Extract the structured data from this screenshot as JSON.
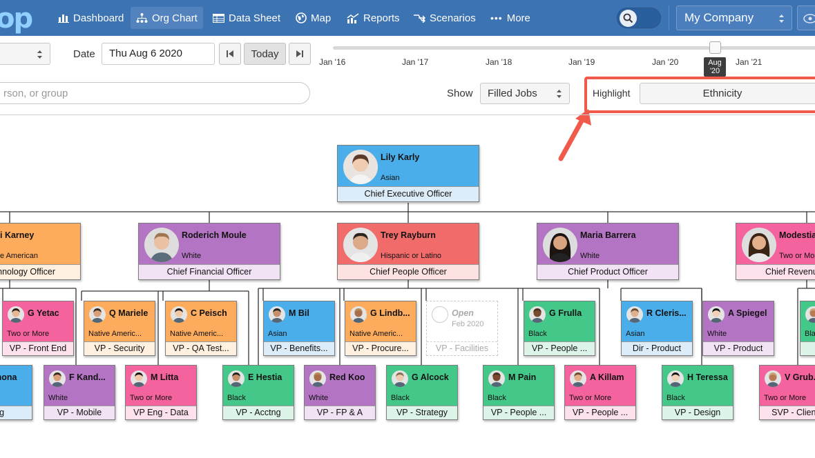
{
  "app": {
    "logo_text": "op",
    "nav": [
      {
        "label": "Dashboard",
        "icon": "bar-chart-icon"
      },
      {
        "label": "Org Chart",
        "icon": "org-chart-icon"
      },
      {
        "label": "Data Sheet",
        "icon": "table-icon"
      },
      {
        "label": "Map",
        "icon": "globe-icon"
      },
      {
        "label": "Reports",
        "icon": "trend-chart-icon"
      },
      {
        "label": "Scenarios",
        "icon": "branch-icon"
      },
      {
        "label": "More",
        "icon": "ellipsis-icon"
      }
    ],
    "active_nav": "Org Chart",
    "company": "My Company"
  },
  "toolbar": {
    "date_label": "Date",
    "date_value": "Thu Aug 6 2020",
    "today_label": "Today",
    "timeline_ticks": [
      "Jan '16",
      "Jan '17",
      "Jan '18",
      "Jan '19",
      "Jan '20",
      "Jan '21"
    ],
    "current_badge_line1": "Aug",
    "current_badge_line2": "'20",
    "search_placeholder": "rson, or group",
    "show_label": "Show",
    "show_value": "Filled Jobs",
    "highlight_label": "Highlight",
    "highlight_value": "Ethnicity"
  },
  "colors": {
    "nav_bg": "#3c73b3",
    "asian": "#4aaeea",
    "white": "#b474c4",
    "hispanic": "#f26b6b",
    "native_american": "#fdab5c",
    "two_or_more": "#f4639d",
    "black": "#44c88a",
    "annotation": "#f15a4a"
  },
  "org_chart": {
    "ceo": {
      "name": "Lily Karly",
      "ethnicity": "Asian",
      "title": "Chief Executive Officer"
    },
    "level2": [
      {
        "name": "i Karney",
        "ethnicity": "e American",
        "title": "hnology Officer",
        "group": "native_american"
      },
      {
        "name": "Roderich Moule",
        "ethnicity": "White",
        "title": "Chief Financial Officer",
        "group": "white"
      },
      {
        "name": "Trey Rayburn",
        "ethnicity": "Hispanic or Latino",
        "title": "Chief People Officer",
        "group": "hispanic"
      },
      {
        "name": "Maria Barrera",
        "ethnicity": "White",
        "title": "Chief Product Officer",
        "group": "white"
      },
      {
        "name": "Modestia",
        "ethnicity": "Two or Mor",
        "title": "Chief Revenu",
        "group": "two_or_more"
      }
    ],
    "level3": [
      {
        "name": "G Yetac",
        "ethnicity": "Two or More",
        "title": "VP - Front End",
        "group": "two_or_more"
      },
      {
        "name": "Q Mariele",
        "ethnicity": "Native Americ...",
        "title": "VP - Security",
        "group": "native_american"
      },
      {
        "name": "C Peisch",
        "ethnicity": "Native Americ...",
        "title": "VP - QA Test...",
        "group": "native_american"
      },
      {
        "name": "M Bil",
        "ethnicity": "Asian",
        "title": "VP - Benefits...",
        "group": "asian"
      },
      {
        "name": "G Lindb...",
        "ethnicity": "Native Americ...",
        "title": "VP - Procure...",
        "group": "native_american"
      },
      {
        "name": "Open",
        "ethnicity": "Feb 2020",
        "title": "VP - Facilities",
        "group": "open"
      },
      {
        "name": "G Frulla",
        "ethnicity": "Black",
        "title": "VP - People ...",
        "group": "black"
      },
      {
        "name": "R Cleris...",
        "ethnicity": "Asian",
        "title": "Dir - Product",
        "group": "asian"
      },
      {
        "name": "A Spiegel",
        "ethnicity": "White",
        "title": "VP - Product",
        "group": "white"
      },
      {
        "name": "",
        "ethnicity": "Bla",
        "title": "S",
        "group": "black"
      }
    ],
    "level4": [
      {
        "name": "Venona",
        "ethnicity": "",
        "title": "Eng",
        "group": "asian"
      },
      {
        "name": "F Kand...",
        "ethnicity": "White",
        "title": "VP - Mobile",
        "group": "white"
      },
      {
        "name": "M Litta",
        "ethnicity": "Two or More",
        "title": "VP Eng - Data",
        "group": "two_or_more"
      },
      {
        "name": "E Hestia",
        "ethnicity": "Black",
        "title": "VP - Acctng",
        "group": "black"
      },
      {
        "name": "Red Koo",
        "ethnicity": "White",
        "title": "VP - FP & A",
        "group": "white"
      },
      {
        "name": "G Alcock",
        "ethnicity": "Black",
        "title": "VP - Strategy",
        "group": "black"
      },
      {
        "name": "M Pain",
        "ethnicity": "Black",
        "title": "VP - People ...",
        "group": "black"
      },
      {
        "name": "A Killam",
        "ethnicity": "Two or More",
        "title": "VP - People ...",
        "group": "two_or_more"
      },
      {
        "name": "H Teressa",
        "ethnicity": "Black",
        "title": "VP - Design",
        "group": "black"
      },
      {
        "name": "V Grub...",
        "ethnicity": "Two or More",
        "title": "SVP - Client",
        "group": "two_or_more"
      }
    ]
  }
}
